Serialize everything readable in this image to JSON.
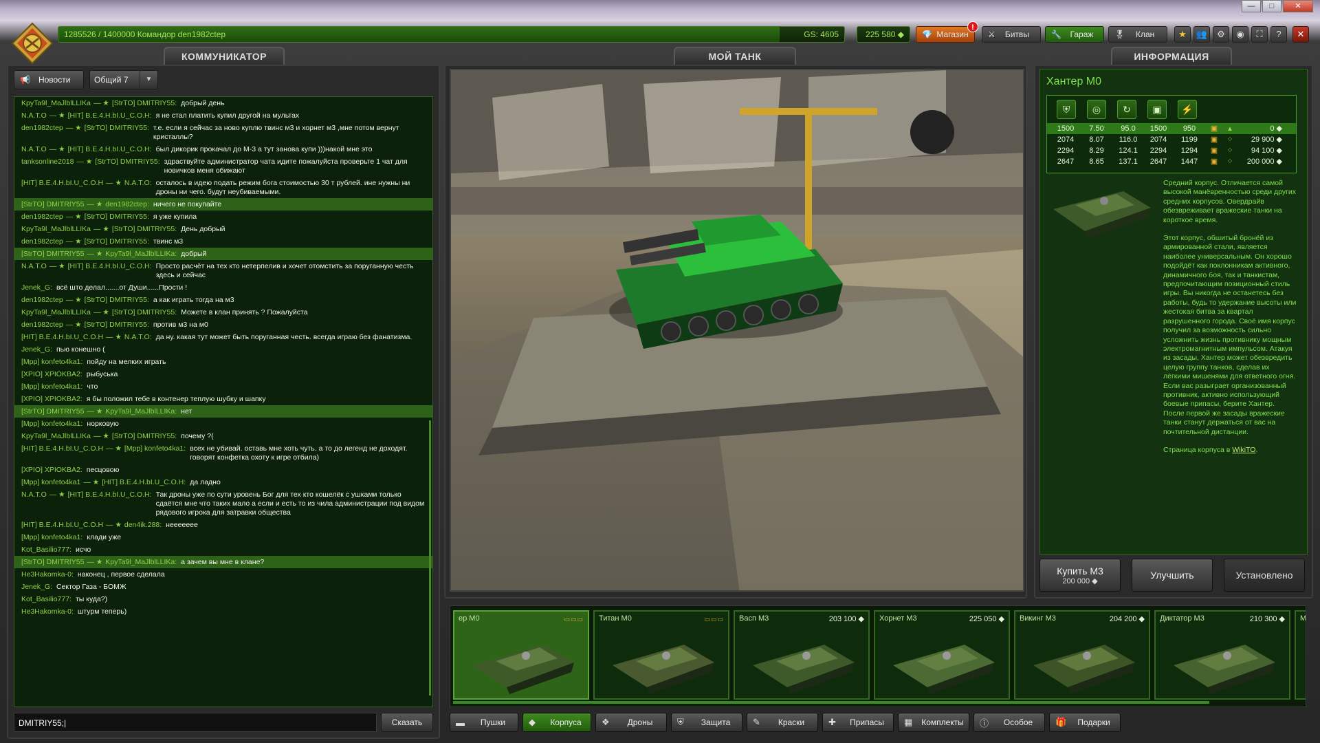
{
  "window": {
    "minimize": "—",
    "maximize": "□",
    "close": "✕"
  },
  "top": {
    "progress_text": "1285526 / 1400000  Командор den1982ctep",
    "progress_fraction": 0.918,
    "gs": "GS: 4605",
    "crystals": "225 580 ◆",
    "buttons": {
      "shop": "Магазин",
      "battles": "Битвы",
      "garage": "Гараж",
      "clan": "Клан"
    },
    "shop_badge": "!",
    "icons": [
      "star-icon",
      "friends-icon",
      "settings-icon",
      "sound-icon",
      "fullscreen-icon",
      "help-icon",
      "exit-icon"
    ]
  },
  "tabs": {
    "communicator": "КОММУНИКАТОР",
    "my_tank": "МОЙ ТАНК",
    "info": "ИНФОРМАЦИЯ"
  },
  "chat": {
    "news_label": "Новости",
    "channel": "Общий 7",
    "input_value": "DMITRIY55;|",
    "say_label": "Сказать",
    "messages": [
      {
        "from": "KpyTa9l_MaJlblLLIKa",
        "to": "[StrTO] DMITRIY55:",
        "text": "добрый день",
        "hl": false
      },
      {
        "from": "N.A.T.O",
        "to": "[HIT] B.E.4.H.bI.U_C.O.H:",
        "text": "я не стал платить купил другой на мультах",
        "hl": false
      },
      {
        "from": "den1982ctep",
        "to": "[StrTO] DMITRIY55:",
        "text": "т.е. если я сейчас за ново куплю твинс м3 и хорнет м3 ,мне потом вернут кристаллы?",
        "hl": false
      },
      {
        "from": "N.A.T.O",
        "to": "[HIT] B.E.4.H.bI.U_C.O.H:",
        "text": "был дикорик прокачал до М-3 а тут занова купи )))накой мне это",
        "hl": false
      },
      {
        "from": "tanksonline2018",
        "to": "[StrTO] DMITRIY55:",
        "text": "здраствуйте администратор чата идите пожалуйста проверьте 1 чат для новичков меня обижают",
        "hl": false
      },
      {
        "from": "[HIT] B.E.4.H.bI.U_C.O.H",
        "to": "N.A.T.O:",
        "text": "осталось в идею подать режим бога стоимостью 30 т рублей. ине нужны ни дроны ни чего. будут неубиваемыми.",
        "hl": false
      },
      {
        "from": "[StrTO] DMITRIY55",
        "to": "den1982ctep:",
        "text": "ничего не покупайте",
        "hl": true
      },
      {
        "from": "den1982ctep",
        "to": "[StrTO] DMITRIY55:",
        "text": "я уже купила",
        "hl": false
      },
      {
        "from": "KpyTa9l_MaJlblLLIKa",
        "to": "[StrTO] DMITRIY55:",
        "text": "День добрый",
        "hl": false
      },
      {
        "from": "den1982ctep",
        "to": "[StrTO] DMITRIY55:",
        "text": "твинс м3",
        "hl": false
      },
      {
        "from": "[StrTO] DMITRIY55",
        "to": "KpyTa9l_MaJlblLLIKa:",
        "text": "добрый",
        "hl": true
      },
      {
        "from": "N.A.T.O",
        "to": "[HIT] B.E.4.H.bI.U_C.O.H:",
        "text": "Просто расчёт на тех кто нетерпелив и хочет отомстить за поруганную честь здесь и сейчас",
        "hl": false
      },
      {
        "from": "Jenek_G:",
        "to": "",
        "text": "всё што делал.......от Души......Прости !",
        "hl": false
      },
      {
        "from": "den1982ctep",
        "to": "[StrTO] DMITRIY55:",
        "text": "а как играть тогда на м3",
        "hl": false
      },
      {
        "from": "KpyTa9l_MaJlblLLIKa",
        "to": "[StrTO] DMITRIY55:",
        "text": "Можете в клан принять ? Пожалуйста",
        "hl": false
      },
      {
        "from": "den1982ctep",
        "to": "[StrTO] DMITRIY55:",
        "text": "против м3 на м0",
        "hl": false
      },
      {
        "from": "[HIT] B.E.4.H.bI.U_C.O.H",
        "to": "N.A.T.O:",
        "text": "да ну. какая тут может быть поруганная честь. всегда играю без фанатизма.",
        "hl": false
      },
      {
        "from": "Jenek_G:",
        "to": "",
        "text": "пью конешно (",
        "hl": false
      },
      {
        "from": "[Mpp] konfeto4ka1:",
        "to": "",
        "text": "пойду на мелких играть",
        "hl": false
      },
      {
        "from": "[XPIO] XPIOKBA2:",
        "to": "",
        "text": "рыбуська",
        "hl": false
      },
      {
        "from": "[Mpp] konfeto4ka1:",
        "to": "",
        "text": "что",
        "hl": false
      },
      {
        "from": "[XPIO] XPIOKBA2:",
        "to": "",
        "text": "я бы положил тебе в контенер теплую шубку и шапку",
        "hl": false
      },
      {
        "from": "[StrTO] DMITRIY55",
        "to": "KpyTa9l_MaJlblLLIKa:",
        "text": "нет",
        "hl": true
      },
      {
        "from": "[Mpp] konfeto4ka1:",
        "to": "",
        "text": "норковую",
        "hl": false
      },
      {
        "from": "KpyTa9l_MaJlblLLIKa",
        "to": "[StrTO] DMITRIY55:",
        "text": "почему ?(",
        "hl": false
      },
      {
        "from": "[HIT] B.E.4.H.bI.U_C.O.H",
        "to": "[Mpp] konfeto4ka1:",
        "text": "всех не убивай. оставь мне хоть чуть. а то до легенд не доходят. говорят конфетка охоту к игре отбила)",
        "hl": false
      },
      {
        "from": "[XPIO] XPIOKBA2:",
        "to": "",
        "text": "песцовою",
        "hl": false
      },
      {
        "from": "[Mpp] konfeto4ka1",
        "to": "[HIT] B.E.4.H.bI.U_C.O.H:",
        "text": "да ладно",
        "hl": false
      },
      {
        "from": "N.A.T.O",
        "to": "[HIT] B.E.4.H.bI.U_C.O.H:",
        "text": "Так дроны уже по сути уровень Бог для тех кто кошелёк с ушками только сдаётся мне что таких мало а если и есть то из чила администрации под видом рядового игрока для затравки общества",
        "hl": false
      },
      {
        "from": "[HIT] B.E.4.H.bI.U_C.O.H",
        "to": "den4ik.288:",
        "text": "неееееее",
        "hl": false
      },
      {
        "from": "[Mpp] konfeto4ka1:",
        "to": "",
        "text": "клади уже",
        "hl": false
      },
      {
        "from": "Kot_Basilio777:",
        "to": "",
        "text": "исчо",
        "hl": false
      },
      {
        "from": "[StrTO] DMITRIY55",
        "to": "KpyTa9l_MaJlblLLIKa:",
        "text": "а зачем вы мне в клане?",
        "hl": true
      },
      {
        "from": "He3Hakomka-0:",
        "to": "",
        "text": "наконец , первое сделала",
        "hl": false
      },
      {
        "from": "Jenek_G:",
        "to": "",
        "text": "Сектор Газа - БОМЖ",
        "hl": false
      },
      {
        "from": "Kot_Basilio777:",
        "to": "",
        "text": "ты куда?)",
        "hl": false
      },
      {
        "from": "He3Hakomka-0:",
        "to": "",
        "text": "штурм теперь)",
        "hl": false
      }
    ]
  },
  "info": {
    "title": "Хантер М0",
    "stat_icons": [
      "armor-icon",
      "speed-icon",
      "turn-icon",
      "weight-icon",
      "power-icon"
    ],
    "rows": [
      {
        "c": [
          "1500",
          "7.50",
          "95.0",
          "1500",
          "950"
        ],
        "price": "0 ◆",
        "current": true
      },
      {
        "c": [
          "2074",
          "8.07",
          "116.0",
          "2074",
          "1199"
        ],
        "price": "29 900 ◆",
        "current": false
      },
      {
        "c": [
          "2294",
          "8.29",
          "124.1",
          "2294",
          "1294"
        ],
        "price": "94 100 ◆",
        "current": false
      },
      {
        "c": [
          "2647",
          "8.65",
          "137.1",
          "2647",
          "1447"
        ],
        "price": "200 000 ◆",
        "current": false
      }
    ],
    "desc_1": "Средний корпус. Отличается самой высокой манёвренностью среди других средних корпусов. Овердрайв обезвреживает вражеские танки на короткое время.",
    "desc_2": "Этот корпус, обшитый бронёй из армированной стали, является наиболее универсальным. Он хорошо подойдёт как поклонникам активного, динамичного боя, так и танкистам, предпочитающим позиционный стиль игры. Вы никогда не останетесь без работы, будь то удержание высоты или жестокая битва за квартал разрушенного города. Своё имя корпус получил за возможность сильно усложнить жизнь противнику мощным электромагнитным импульсом. Атакуя из засады, Хантер может обезвредить целую группу танков, сделав их лёгкими мишенями для ответного огня. Если вас разыграет организованный противник, активно использующий боевые припасы, берите Хантер. После первой же засады вражеские танки станут держаться от вас на почтительной дистанции.",
    "wiki_prefix": "Страница корпуса в ",
    "wiki_link": "WikiTO",
    "wiki_suffix": ".",
    "buy_label": "Купить М3",
    "buy_price": "200 000 ◆",
    "upgrade_label": "Улучшить",
    "installed_label": "Установлено"
  },
  "items": [
    {
      "name": "ер М0",
      "price": "",
      "slots": "▭▭▭",
      "selected": true
    },
    {
      "name": "Титан М0",
      "price": "",
      "slots": "▭▭▭",
      "selected": false
    },
    {
      "name": "Васп М3",
      "price": "203 100 ◆",
      "slots": "",
      "selected": false
    },
    {
      "name": "Хорнет М3",
      "price": "225 050 ◆",
      "slots": "",
      "selected": false
    },
    {
      "name": "Викинг М3",
      "price": "204 200 ◆",
      "slots": "",
      "selected": false
    },
    {
      "name": "Диктатор М3",
      "price": "210 300 ◆",
      "slots": "",
      "selected": false
    },
    {
      "name": "Мамонт",
      "price": "",
      "slots": "",
      "selected": false
    }
  ],
  "categories": [
    {
      "label": "Пушки",
      "icon": "gun-icon"
    },
    {
      "label": "Корпуса",
      "icon": "hull-icon"
    },
    {
      "label": "Дроны",
      "icon": "drone-icon"
    },
    {
      "label": "Защита",
      "icon": "shield-icon"
    },
    {
      "label": "Краски",
      "icon": "paint-icon"
    },
    {
      "label": "Припасы",
      "icon": "supplies-icon"
    },
    {
      "label": "Комплекты",
      "icon": "kits-icon"
    },
    {
      "label": "Особое",
      "icon": "special-icon"
    },
    {
      "label": "Подарки",
      "icon": "gift-icon"
    }
  ],
  "colors": {
    "accent_green": "#7ee04a",
    "highlight_row": "#2e6219",
    "shop_orange": "#e07a24",
    "panel": "#2a2a2a"
  }
}
